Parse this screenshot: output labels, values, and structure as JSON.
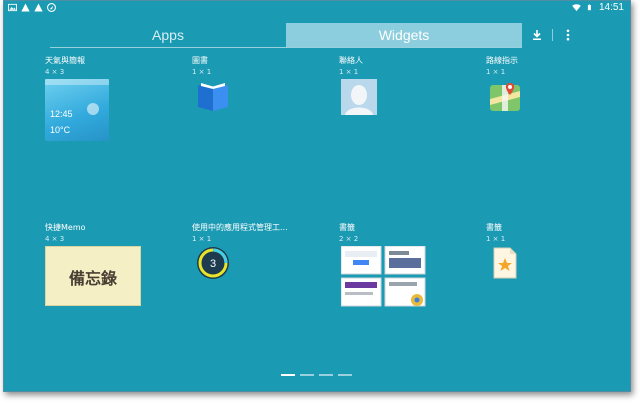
{
  "status_bar": {
    "time": "14:51",
    "left_icons": [
      "image-icon",
      "warning-icon",
      "warning-icon",
      "location-icon"
    ],
    "right_icons": [
      "wifi-icon",
      "battery-icon"
    ]
  },
  "tabs": [
    {
      "label": "Apps",
      "selected": false
    },
    {
      "label": "Widgets",
      "selected": true
    }
  ],
  "actions": {
    "download_icon": "download-icon",
    "menu_icon": "more-vert-icon"
  },
  "widgets": [
    {
      "name": "天氣與簡報",
      "size": "4 × 3",
      "preview": "weather-preview"
    },
    {
      "name": "圖書",
      "size": "1 × 1",
      "preview": "books-icon"
    },
    {
      "name": "聯絡人",
      "size": "1 × 1",
      "preview": "contact-icon"
    },
    {
      "name": "路線指示",
      "size": "1 × 1",
      "preview": "maps-icon"
    },
    {
      "name": "快捷Memo",
      "size": "4 × 3",
      "preview": "memo-preview"
    },
    {
      "name": "使用中的應用程式管理工...",
      "size": "1 × 1",
      "preview": "app-manager-icon"
    },
    {
      "name": "書籤",
      "size": "2 × 2",
      "preview": "bookmarks-preview"
    },
    {
      "name": "書籤",
      "size": "1 × 1",
      "preview": "bookmark-icon"
    }
  ],
  "weather_preview": {
    "time": "12:45",
    "temp": "10°C"
  },
  "memo_preview": {
    "text": "備忘錄"
  },
  "app_manager_preview": {
    "count": "3"
  },
  "pager": {
    "pages": 4,
    "current": 1
  },
  "colors": {
    "background": "#1b9ab3",
    "tab_selected": "#8ccedd",
    "text": "#ffffff"
  }
}
